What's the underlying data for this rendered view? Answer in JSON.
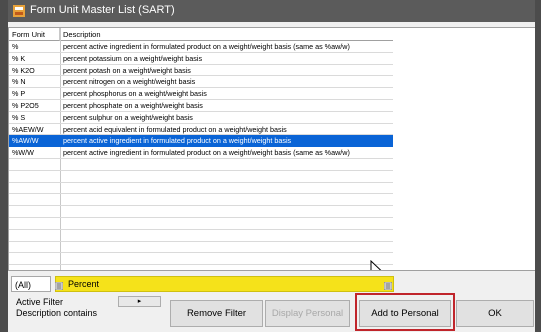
{
  "window": {
    "title": "Form Unit Master List (SART)"
  },
  "grid": {
    "columns": [
      "Form Unit",
      "Description"
    ],
    "rows": [
      {
        "unit": "%",
        "description": "percent active ingredient in formulated product on a weight/weight basis (same as %aw/w)",
        "selected": false
      },
      {
        "unit": "% K",
        "description": "percent potassium on a weight/weight basis",
        "selected": false
      },
      {
        "unit": "% K2O",
        "description": "percent potash on a weight/weight basis",
        "selected": false
      },
      {
        "unit": "% N",
        "description": "percent nitrogen on a weight/weight basis",
        "selected": false
      },
      {
        "unit": "% P",
        "description": "percent phosphorus on a weight/weight basis",
        "selected": false
      },
      {
        "unit": "% P2O5",
        "description": "percent phosphate on a weight/weight basis",
        "selected": false
      },
      {
        "unit": "% S",
        "description": "percent sulphur on a weight/weight basis",
        "selected": false
      },
      {
        "unit": "%AEW/W",
        "description": "percent acid equivalent in formulated product on a weight/weight basis",
        "selected": false
      },
      {
        "unit": "%AW/W",
        "description": "percent active ingredient in formulated product on a weight/weight basis",
        "selected": true
      },
      {
        "unit": "%W/W",
        "description": "percent active ingredient in formulated product on a weight/weight basis (same as %aw/w)",
        "selected": false
      }
    ]
  },
  "filter": {
    "scope": "(All)",
    "value": "Percent",
    "active_filter_label": "Active Filter",
    "description_contains_label": "Description contains",
    "arrow_label": "▸"
  },
  "buttons": {
    "remove_filter": "Remove Filter",
    "display_personal": "Display Personal",
    "add_to_personal": "Add to Personal",
    "ok": "OK"
  },
  "colors": {
    "selection": "#0a64d6",
    "filter_highlight": "#f5e21a",
    "annotation": "#c0252b"
  }
}
